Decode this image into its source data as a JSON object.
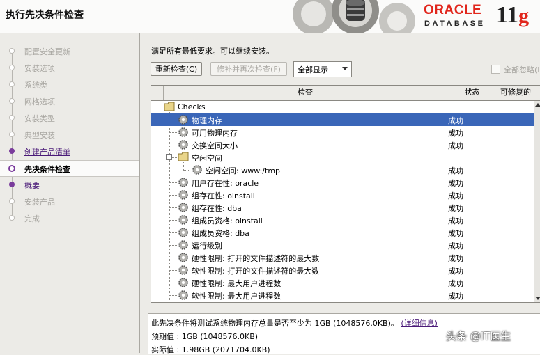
{
  "window": {
    "title": "执行先决条件检查"
  },
  "logo": {
    "brand": "ORACLE",
    "product": "DATABASE",
    "version": "11",
    "version_suffix": "g"
  },
  "steps": [
    {
      "label": "配置安全更新",
      "state": "disabled"
    },
    {
      "label": "安装选项",
      "state": "disabled"
    },
    {
      "label": "系统类",
      "state": "disabled"
    },
    {
      "label": "网格选项",
      "state": "disabled"
    },
    {
      "label": "安装类型",
      "state": "disabled"
    },
    {
      "label": "典型安装",
      "state": "disabled"
    },
    {
      "label": "创建产品清单",
      "state": "link"
    },
    {
      "label": "先决条件检查",
      "state": "current"
    },
    {
      "label": "概要",
      "state": "link"
    },
    {
      "label": "安装产品",
      "state": "disabled"
    },
    {
      "label": "完成",
      "state": "disabled"
    }
  ],
  "main": {
    "message": "满足所有最低要求。可以继续安装。",
    "recheck_label": "重新检查(C)",
    "fix_label": "修补并再次检查(F)",
    "filter_value": "全部显示",
    "ignore_all_label": "全部忽略(I)"
  },
  "table": {
    "headers": {
      "check": "检查",
      "status": "状态",
      "fixable": "可修复的"
    },
    "root": "Checks",
    "rows": [
      {
        "name": "物理内存",
        "status": "成功",
        "selected": true
      },
      {
        "name": "可用物理内存",
        "status": "成功"
      },
      {
        "name": "交换空间大小",
        "status": "成功"
      },
      {
        "name": "空闲空间",
        "status": "",
        "group": true
      },
      {
        "name": "空闲空间: www:/tmp",
        "status": "成功",
        "child": true
      },
      {
        "name": "用户存在性: oracle",
        "status": "成功"
      },
      {
        "name": "组存在性: oinstall",
        "status": "成功"
      },
      {
        "name": "组存在性: dba",
        "status": "成功"
      },
      {
        "name": "组成员资格: oinstall",
        "status": "成功"
      },
      {
        "name": "组成员资格: dba",
        "status": "成功"
      },
      {
        "name": "运行级别",
        "status": "成功"
      },
      {
        "name": "硬性限制: 打开的文件描述符的最大数",
        "status": "成功"
      },
      {
        "name": "软性限制: 打开的文件描述符的最大数",
        "status": "成功"
      },
      {
        "name": "硬性限制: 最大用户进程数",
        "status": "成功"
      },
      {
        "name": "软性限制: 最大用户进程数",
        "status": "成功"
      }
    ]
  },
  "detail": {
    "description": "此先决条件将测试系统物理内存总量是否至少为 1GB (1048576.0KB)。",
    "more_link": "(详细信息)",
    "expected_label": "预期值",
    "expected_value": "1GB (1048576.0KB)",
    "actual_label": "实际值",
    "actual_value": "1.98GB (2071704.0KB)"
  },
  "watermark": "头条 @IT医生"
}
